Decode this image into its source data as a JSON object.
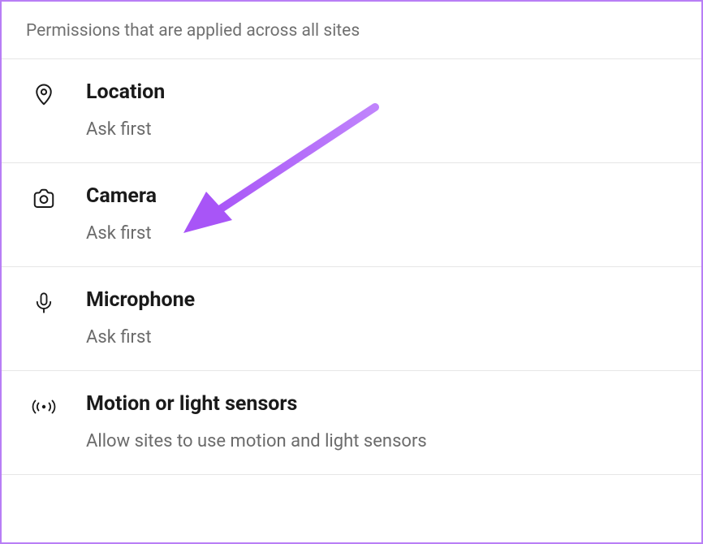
{
  "header": {
    "description": "Permissions that are applied across all sites"
  },
  "permissions": [
    {
      "icon": "location-icon",
      "title": "Location",
      "subtitle": "Ask first"
    },
    {
      "icon": "camera-icon",
      "title": "Camera",
      "subtitle": "Ask first"
    },
    {
      "icon": "microphone-icon",
      "title": "Microphone",
      "subtitle": "Ask first"
    },
    {
      "icon": "motion-sensor-icon",
      "title": "Motion or light sensors",
      "subtitle": "Allow sites to use motion and light sensors"
    }
  ],
  "annotation": {
    "color": "#a855f7"
  }
}
